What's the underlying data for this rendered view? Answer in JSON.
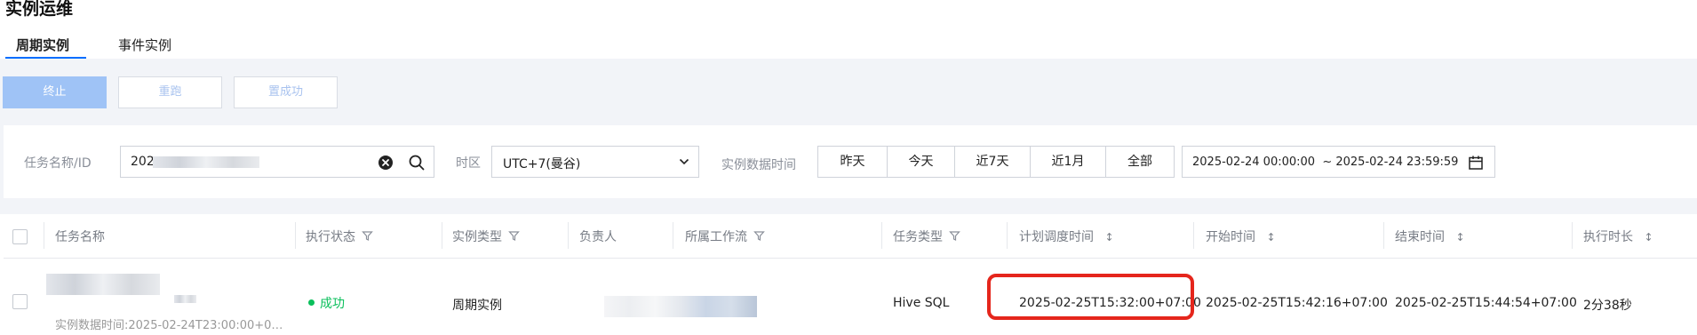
{
  "page": {
    "title": "实例运维"
  },
  "tabs": [
    {
      "label": "周期实例",
      "active": true
    },
    {
      "label": "事件实例",
      "active": false
    }
  ],
  "toolbar": {
    "terminate_label": "终止",
    "rerun_label": "重跑",
    "set_success_label": "置成功"
  },
  "filters": {
    "task_name_label": "任务名称/ID",
    "task_name_value": "202",
    "timezone_label": "时区",
    "timezone_value": "UTC+7(曼谷)",
    "data_time_label": "实例数据时间",
    "quick_ranges": [
      "昨天",
      "今天",
      "近7天",
      "近1月",
      "全部"
    ],
    "date_range": "2025-02-24 00:00:00  ~ 2025-02-24 23:59:59"
  },
  "table": {
    "headers": [
      "任务名称",
      "执行状态",
      "实例类型",
      "负责人",
      "所属工作流",
      "任务类型",
      "计划调度时间",
      "开始时间",
      "结束时间",
      "执行时长"
    ],
    "rows": [
      {
        "instance_data_time": "实例数据时间:2025-02-24T23:00:00+0…",
        "status": "成功",
        "instance_type": "周期实例",
        "task_type": "Hive SQL",
        "scheduled_time": "2025-02-25T15:32:00+07:00",
        "start_time": "2025-02-25T15:42:16+07:00",
        "end_time": "2025-02-25T15:44:54+07:00",
        "duration": "2分38秒"
      }
    ]
  },
  "colors": {
    "accent": "#006eff",
    "success": "#0abf5b",
    "highlight_border": "#e5261c"
  }
}
